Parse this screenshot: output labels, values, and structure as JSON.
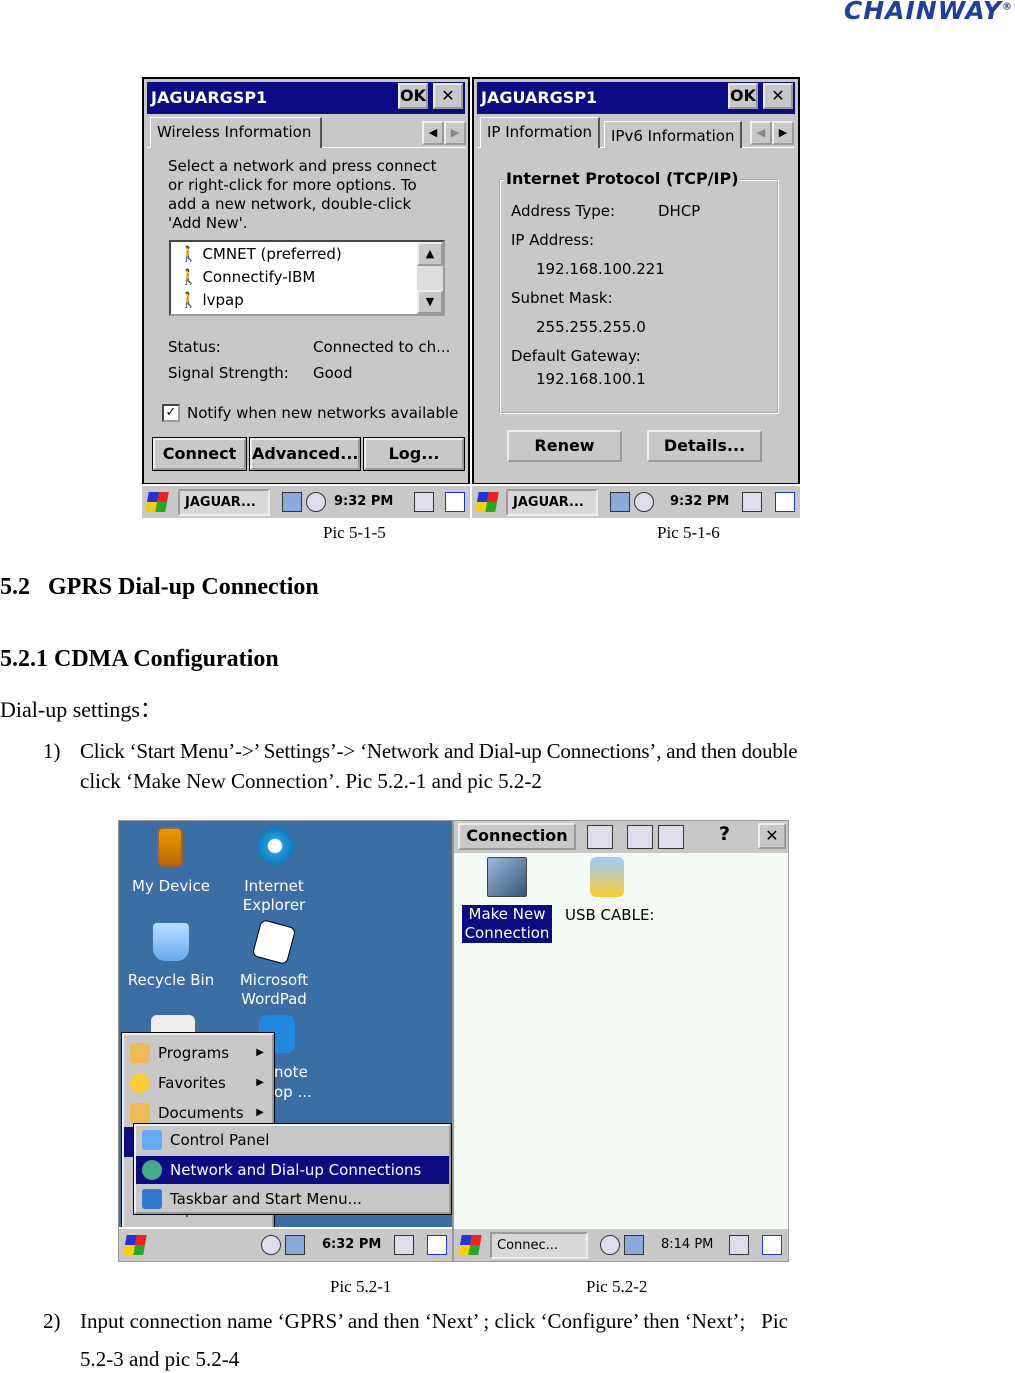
{
  "header": {
    "logo": "CHAINWAY",
    "registered": "®"
  },
  "pic_5_1_5": {
    "window_title": "JAGUARGSP1",
    "ok": "OK",
    "close": "✕",
    "tab": "Wireless Information",
    "instructions": [
      "Select a network and press connect",
      "or right-click for more options.  To",
      "add a new network, double-click",
      "'Add New'."
    ],
    "networks": [
      "CMNET (preferred)",
      "Connectify-IBM",
      "lvpap"
    ],
    "status_label": "Status:",
    "status_value": "Connected to ch...",
    "signal_label": "Signal Strength:",
    "signal_value": "Good",
    "notify_label": "Notify when new networks available",
    "notify_checked": true,
    "buttons": {
      "connect": "Connect",
      "advanced": "Advanced...",
      "log": "Log..."
    },
    "taskbar": {
      "task": "JAGUAR...",
      "time": "9:32 PM"
    }
  },
  "pic_5_1_6": {
    "window_title": "JAGUARGSP1",
    "ok": "OK",
    "close": "✕",
    "tabs": [
      "IP Information",
      "IPv6 Information"
    ],
    "group_title": "Internet Protocol (TCP/IP)",
    "address_type_label": "Address Type:",
    "address_type": "DHCP",
    "ip_label": "IP Address:",
    "ip": "192.168.100.221",
    "subnet_label": "Subnet Mask:",
    "subnet": "255.255.255.0",
    "gateway_label": "Default Gateway:",
    "gateway": "192.168.100.1",
    "buttons": {
      "renew": "Renew",
      "details": "Details..."
    },
    "taskbar": {
      "task": "JAGUAR...",
      "time": "9:32 PM"
    }
  },
  "captions": {
    "pic_5_1_5": "Pic 5-1-5",
    "pic_5_1_6": "Pic 5-1-6",
    "pic_5_2_1": "Pic 5.2-1",
    "pic_5_2_2": "Pic 5.2-2"
  },
  "section": {
    "heading": "5.2   GPRS Dial-up Connection",
    "subheading": "5.2.1 CDMA Configuration",
    "intro": "Dial-up settings："
  },
  "steps": [
    {
      "num": "1)",
      "lines": [
        "Click ‘Start Menu’->’ Settings’-> ‘Network and Dial-up Connections’, and then double",
        "click ‘Make New Connection’. Pic 5.2.-1 and pic 5.2-2"
      ]
    },
    {
      "num": "2)",
      "lines": [
        "Input connection name ‘GPRS’ and then ‘Next’ ; click ‘Configure’ then ‘Next’;   Pic",
        "5.2-3 and pic 5.2-4"
      ]
    }
  ],
  "pic_5_2_1": {
    "desktop_icons": [
      "My Device",
      "Internet Explorer",
      "Recycle Bin",
      "Microsoft WordPad"
    ],
    "partial_icon_text": [
      "note",
      "op ..."
    ],
    "start_menu": [
      "Programs",
      "Favorites",
      "Documents"
    ],
    "suspend_partial": "Suspend",
    "settings_submenu": [
      "Control Panel",
      "Network and Dial-up Connections",
      "Taskbar and Start Menu..."
    ],
    "highlighted": "Network and Dial-up Connections",
    "taskbar": {
      "time": "6:32 PM"
    }
  },
  "pic_5_2_2": {
    "toolbar_button": "Connection",
    "help": "?",
    "close": "✕",
    "items": [
      {
        "label_lines": [
          "Make New",
          "Connection"
        ],
        "selected": true
      },
      {
        "label_lines": [
          "USB CABLE:"
        ],
        "selected": false
      }
    ],
    "taskbar": {
      "task": "Connec...",
      "time": "8:14 PM"
    }
  },
  "colors": {
    "titlebar": "#0b0b84",
    "desktop": "#3a6ea5",
    "window": "#c8c8c8",
    "logo": "#1f3f9a"
  }
}
